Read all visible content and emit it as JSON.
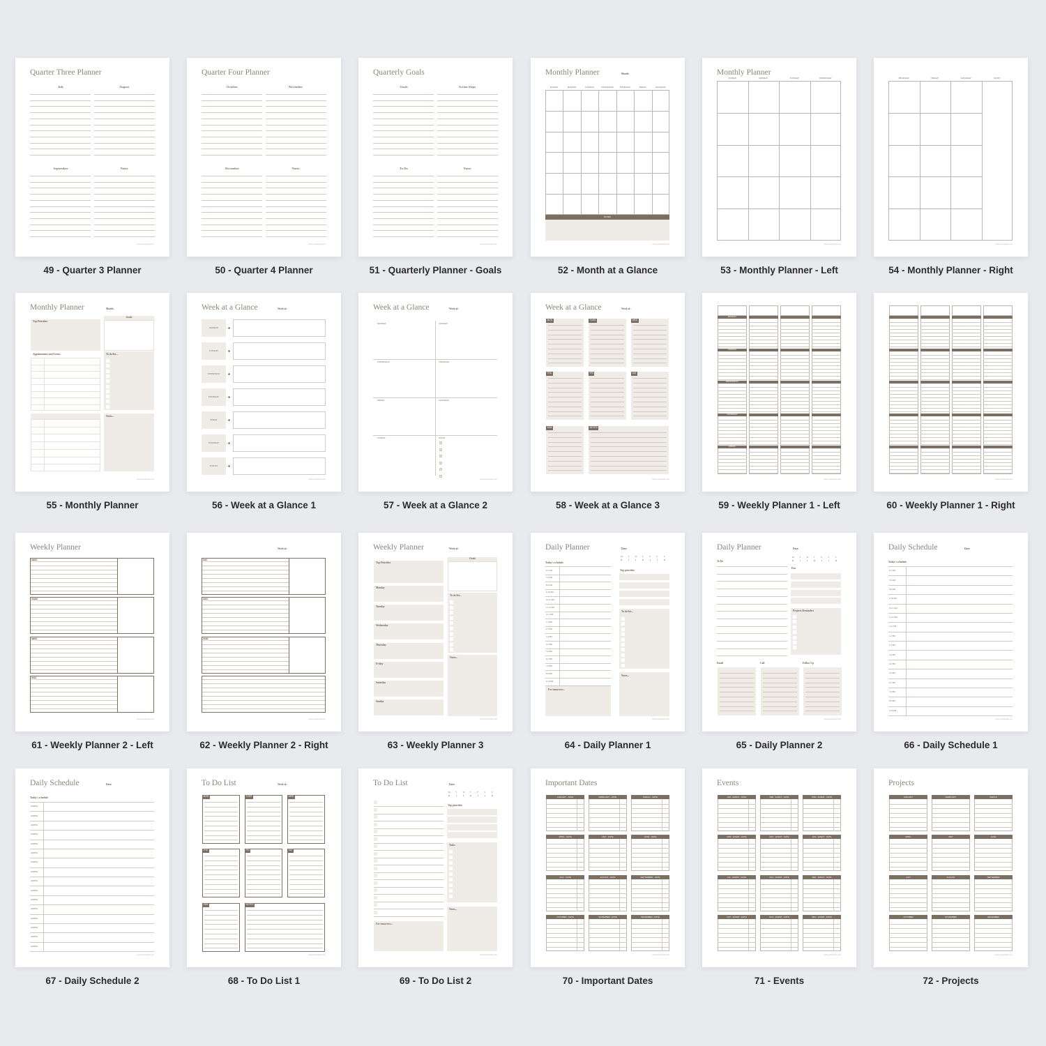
{
  "footer": "www.yourwebsite.com",
  "weekday_letters": [
    "M",
    "T",
    "W",
    "T",
    "F",
    "S",
    "S"
  ],
  "colors": {
    "background": "#e9eaee",
    "accent_brown": "#7b6e62",
    "beige_fill": "#efebe6",
    "rule_line": "#cfc9c2",
    "title_text": "#8d847b"
  },
  "pages": [
    {
      "caption": "49 - Quarter 3 Planner",
      "title": "Quarter Three Planner",
      "labels": [
        "July",
        "August",
        "September",
        "Notes"
      ]
    },
    {
      "caption": "50 - Quarter 4 Planner",
      "title": "Quarter Four Planner",
      "labels": [
        "October",
        "November",
        "December",
        "Notes"
      ]
    },
    {
      "caption": "51 - Quarterly Planner - Goals",
      "title": "Quarterly Goals",
      "labels": [
        "Goals",
        "Action Steps",
        "To Do",
        "Notes"
      ]
    },
    {
      "caption": "52 - Month at a Glance",
      "title": "Monthly Planner",
      "header_label": "Month:",
      "labels": [
        "SUNDAY",
        "MONDAY",
        "TUESDAY",
        "WEDNESDAY",
        "THURSDAY",
        "FRIDAY",
        "SATURDAY",
        "NOTES"
      ]
    },
    {
      "caption": "53 - Monthly Planner - Left",
      "title": "Monthly Planner",
      "labels": [
        "SUNDAY",
        "MONDAY",
        "TUESDAY",
        "WEDNESDAY"
      ]
    },
    {
      "caption": "54 - Monthly Planner - Right",
      "labels": [
        "THURSDAY",
        "FRIDAY",
        "SATURDAY",
        "NOTES"
      ]
    },
    {
      "caption": "55 - Monthly Planner",
      "title": "Monthly Planner",
      "header_label": "Month:",
      "labels": [
        "Top Priorities",
        "Goals",
        "Appointments and Events",
        "To do list...",
        "Notes..."
      ]
    },
    {
      "caption": "56 - Week at a Glance 1",
      "title": "Week at a Glance",
      "header_label": "Week of:",
      "labels": [
        "MONDAY",
        "TUESDAY",
        "WEDNESDAY",
        "THURSDAY",
        "FRIDAY",
        "SATURDAY",
        "SUNDAY"
      ]
    },
    {
      "caption": "57 - Week at a Glance 2",
      "title": "Week at a Glance",
      "header_label": "Week of:",
      "labels": [
        "MONDAY",
        "TUESDAY",
        "WEDNESDAY",
        "THURSDAY",
        "FRIDAY",
        "SATURDAY",
        "SUNDAY",
        "NOTES"
      ]
    },
    {
      "caption": "58 - Week at a Glance 3",
      "title": "Week at a Glance",
      "header_label": "Week of:",
      "labels": [
        "MON",
        "TUES",
        "WED",
        "THU",
        "FRI",
        "SAT",
        "SUN",
        "NOTES"
      ]
    },
    {
      "caption": "59 - Weekly Planner 1 - Left",
      "labels": [
        "MONDAY",
        "TUESDAY",
        "WEDNESDAY",
        "THURSDAY",
        "FRIDAY"
      ]
    },
    {
      "caption": "60 - Weekly Planner 1 - Right"
    },
    {
      "caption": "61 - Weekly Planner 2 - Left",
      "title": "Weekly Planner",
      "labels": [
        "MON",
        "TUES",
        "WED",
        "THU"
      ]
    },
    {
      "caption": "62 - Weekly Planner 2 - Right",
      "header_label": "Week of:",
      "labels": [
        "FRI",
        "SAT",
        "SUN"
      ]
    },
    {
      "caption": "63 - Weekly Planner 3",
      "title": "Weekly Planner",
      "header_label": "Week of:",
      "labels": [
        "Top Priorities",
        "Goals",
        "Monday",
        "Tuesday",
        "Wednesday",
        "Thursday",
        "Friday",
        "Saturday",
        "Sunday",
        "To do list...",
        "Notes..."
      ]
    },
    {
      "caption": "64 - Daily Planner 1",
      "title": "Daily Planner",
      "header_label": "Date:",
      "labels": [
        "Today's schedule",
        "Top priorities",
        "To do list...",
        "Notes...",
        "For tomorrow..."
      ],
      "times": [
        "6-7 AM",
        "7-8 AM",
        "8-9 AM",
        "9-10 AM",
        "10-11 AM",
        "11-12 AM",
        "12-1 PM",
        "1-2 PM",
        "2-3 PM",
        "3-4 PM",
        "4-5 PM",
        "5-6 PM",
        "6-7 PM",
        "7-8 PM",
        "8-9 PM",
        "9-10 PM"
      ]
    },
    {
      "caption": "65 - Daily Planner 2",
      "title": "Daily Planner",
      "header_label": "Date:",
      "labels": [
        "To Do",
        "Due",
        "Projects Reminders",
        "Email",
        "Call",
        "Follow Up"
      ]
    },
    {
      "caption": "66 - Daily Schedule 1",
      "title": "Daily Schedule",
      "header_label": "Date:",
      "labels": [
        "Today's schedule"
      ],
      "times": [
        "6-7 AM",
        "7-8 AM",
        "8-9 AM",
        "9-10 AM",
        "10-11 AM",
        "11-12 AM",
        "12-1 PM",
        "1-2 PM",
        "2-3 PM",
        "3-4 PM",
        "4-5 PM",
        "5-6 PM",
        "6-7 PM",
        "7-8 PM",
        "8-9 PM",
        "9-10 PM"
      ]
    },
    {
      "caption": "67 - Daily Schedule 2",
      "title": "Daily Schedule",
      "header_label": "Date:",
      "labels": [
        "Today's schedule"
      ],
      "times": [
        "AM/PM",
        "AM/PM",
        "AM/PM",
        "AM/PM",
        "AM/PM",
        "AM/PM",
        "AM/PM",
        "AM/PM",
        "AM/PM",
        "AM/PM",
        "AM/PM",
        "AM/PM",
        "AM/PM",
        "AM/PM",
        "AM/PM",
        "AM/PM"
      ]
    },
    {
      "caption": "68 - To Do List 1",
      "title": "To Do List",
      "header_label": "Week of:",
      "labels": [
        "MON",
        "TUES",
        "WED",
        "THU",
        "FRI",
        "SAT",
        "SUN",
        "NOTES"
      ]
    },
    {
      "caption": "69 - To Do List 2",
      "title": "To Do List",
      "header_label": "Date:",
      "labels": [
        "Top priorities",
        "Tasks",
        "Notes...",
        "For tomorrow..."
      ]
    },
    {
      "caption": "70 - Important Dates",
      "title": "Important Dates",
      "labels": [
        "JANUARY - DATE",
        "FEBRUARY - DATE",
        "MARCH - DATE",
        "APRIL - DATE",
        "MAY - DATE",
        "JUNE - DATE",
        "JULY - DATE",
        "AUGUST - DATE",
        "SEPTEMBER - DATE",
        "OCTOBER - DATE",
        "NOVEMBER - DATE",
        "DECEMBER - DATE"
      ]
    },
    {
      "caption": "71 - Events",
      "title": "Events",
      "labels": [
        "JAN - EVENT - DATE",
        "FEB - EVENT - DATE",
        "MAR - EVENT - DATE",
        "APR - EVENT - DATE",
        "MAY - EVENT - DATE",
        "JUN - EVENT - DATE",
        "JUL - EVENT - DATE",
        "AUG - EVENT - DATE",
        "SEP - EVENT - DATE",
        "OCT - EVENT - DATE",
        "NOV - EVENT - DATE",
        "DEC - EVENT - DATE"
      ]
    },
    {
      "caption": "72 - Projects",
      "title": "Projects",
      "labels": [
        "JANUARY",
        "FEBRUARY",
        "MARCH",
        "APRIL",
        "MAY",
        "JUNE",
        "JULY",
        "AUGUST",
        "SEPTEMBER",
        "OCTOBER",
        "NOVEMBER",
        "DECEMBER"
      ]
    }
  ]
}
